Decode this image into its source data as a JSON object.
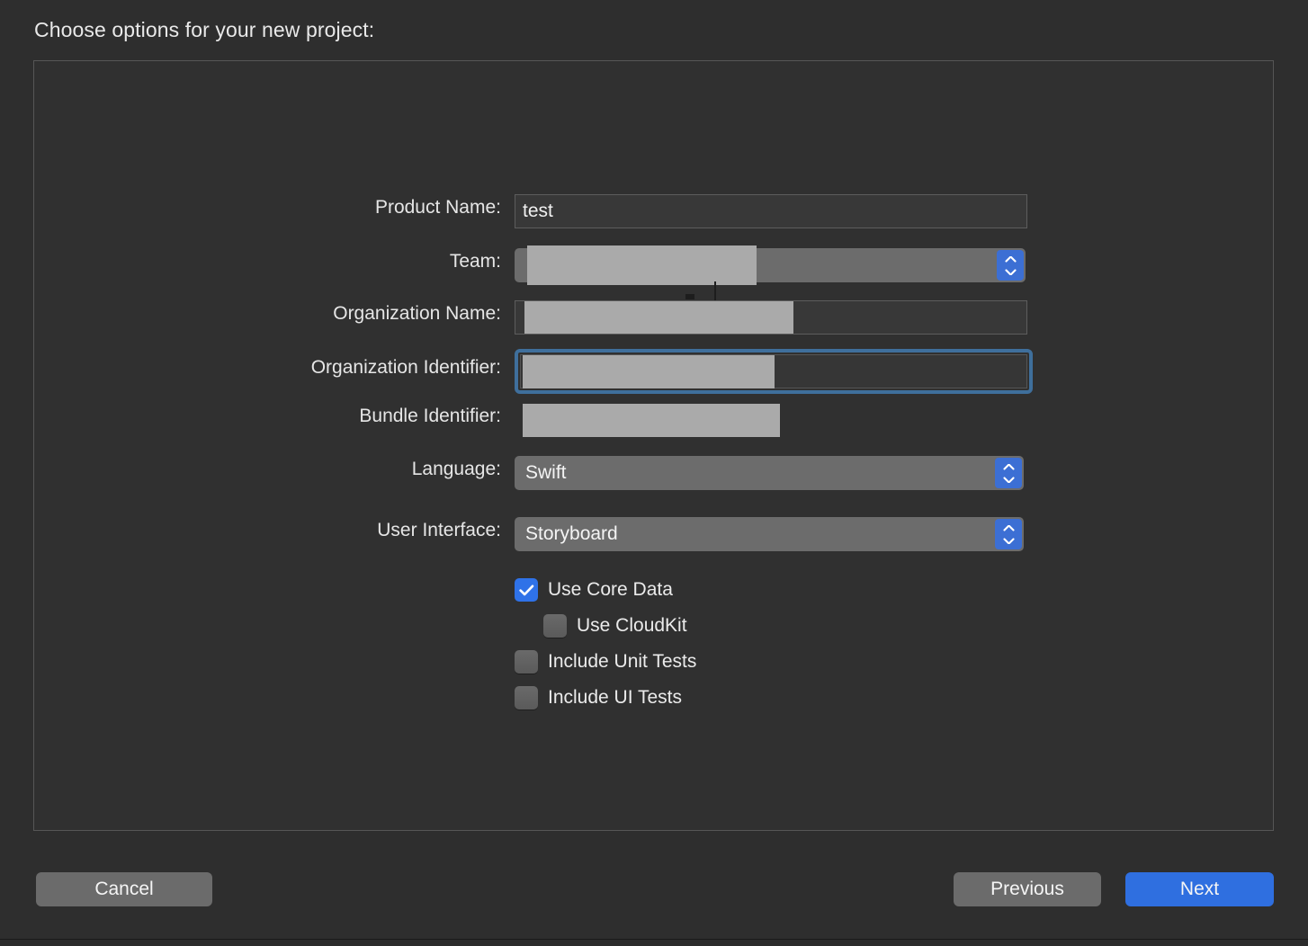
{
  "sheet": {
    "title": "Choose options for your new project:"
  },
  "form": {
    "rows": [
      {
        "label": "Product Name:",
        "value": "test",
        "type": "textfield",
        "redacted": false,
        "focused": false
      },
      {
        "label": "Team:",
        "value": "",
        "type": "popup",
        "redacted": true,
        "focused": false
      },
      {
        "label": "Organization Name:",
        "value": "",
        "type": "textfield",
        "redacted": true,
        "focused": false
      },
      {
        "label": "Organization Identifier:",
        "value": "",
        "type": "textfield",
        "redacted": true,
        "focused": true
      },
      {
        "label": "Bundle Identifier:",
        "value": "",
        "type": "static",
        "redacted": true,
        "focused": false
      },
      {
        "label": "Language:",
        "value": "Swift",
        "type": "popup",
        "redacted": false,
        "focused": false
      },
      {
        "label": "User Interface:",
        "value": "Storyboard",
        "type": "popup",
        "redacted": false,
        "focused": false
      }
    ]
  },
  "checkboxes": [
    {
      "label": "Use Core Data",
      "checked": true,
      "indented": false
    },
    {
      "label": "Use CloudKit",
      "checked": false,
      "indented": true
    },
    {
      "label": "Include Unit Tests",
      "checked": false,
      "indented": false
    },
    {
      "label": "Include UI Tests",
      "checked": false,
      "indented": false
    }
  ],
  "footer": {
    "cancel_label": "Cancel",
    "previous_label": "Previous",
    "next_label": "Next"
  },
  "colors": {
    "background": "#2e2e2e",
    "panel": "#303030",
    "accent_blue": "#2f6fe0",
    "stepper_blue": "#3c6fd4",
    "focus_ring": "#3f6f9c",
    "redaction": "#aaaaaa",
    "button_gray": "#6b6b6b",
    "popup_gray": "#6c6c6c"
  }
}
